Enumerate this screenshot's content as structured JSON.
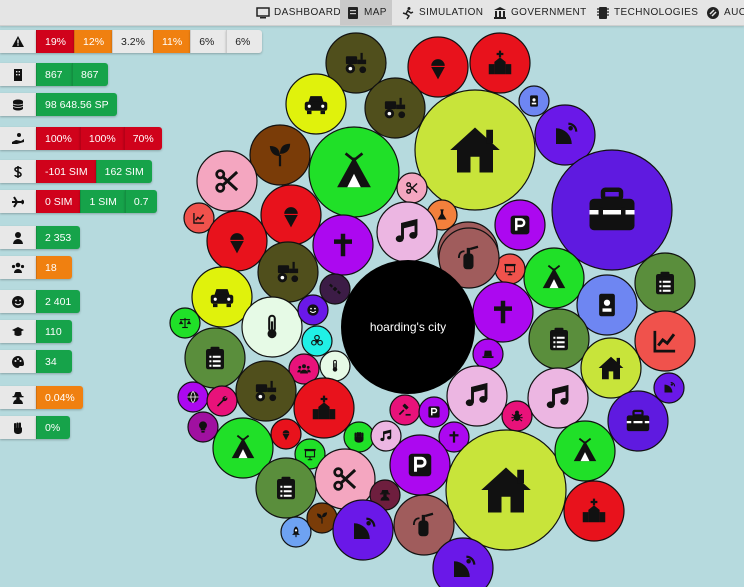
{
  "nav": {
    "items": [
      {
        "label": "DASHBOARD",
        "icon": "monitor-icon",
        "active": false
      },
      {
        "label": "MAP",
        "icon": "map-icon",
        "active": true
      },
      {
        "label": "SIMULATION",
        "icon": "running-icon",
        "active": false
      },
      {
        "label": "GOVERNMENT",
        "icon": "landmark-icon",
        "active": false
      },
      {
        "label": "TECHNOLOGIES",
        "icon": "microchip-icon",
        "active": false
      },
      {
        "label": "AUCT",
        "icon": "gavel-icon",
        "active": false
      }
    ]
  },
  "colors": {
    "red": "#d0021b",
    "orange": "#f08010",
    "green": "#16a34a",
    "grey": "#e9e9e9",
    "background": "#b6dade"
  },
  "stats": [
    {
      "name": "warning",
      "icon": "warning-icon",
      "cells": [
        {
          "text": "19%",
          "color": "red"
        },
        {
          "text": "12%",
          "color": "orange"
        },
        {
          "text": "3.2%",
          "color": "grey"
        },
        {
          "text": "11%",
          "color": "orange"
        },
        {
          "text": "6%",
          "color": "grey"
        },
        {
          "text": "6%",
          "color": "grey"
        }
      ]
    },
    {
      "name": "buildings",
      "icon": "building-icon",
      "cells": [
        {
          "text": "867",
          "color": "green"
        },
        {
          "text": "867",
          "color": "green"
        }
      ]
    },
    {
      "name": "money",
      "icon": "coins-icon",
      "cells": [
        {
          "text": "98 648.56 SP",
          "color": "green"
        }
      ]
    },
    {
      "name": "donation",
      "icon": "hand-holding-icon",
      "cells": [
        {
          "text": "100%",
          "color": "red"
        },
        {
          "text": "100%",
          "color": "red"
        },
        {
          "text": "70%",
          "color": "red"
        }
      ]
    },
    {
      "name": "dollar",
      "icon": "dollar-icon",
      "cells": [
        {
          "text": "-101 SIM",
          "color": "red"
        },
        {
          "text": "162 SIM",
          "color": "green"
        }
      ]
    },
    {
      "name": "travel",
      "icon": "plane-icon",
      "cells": [
        {
          "text": "0 SIM",
          "color": "red"
        },
        {
          "text": "1 SIM",
          "color": "green"
        },
        {
          "text": "0.7",
          "color": "green"
        }
      ]
    },
    {
      "name": "population",
      "icon": "user-icon",
      "cells": [
        {
          "text": "2 353",
          "color": "green"
        }
      ]
    },
    {
      "name": "groups",
      "icon": "users-icon",
      "cells": [
        {
          "text": "18",
          "color": "orange"
        }
      ]
    },
    {
      "name": "happiness",
      "icon": "smile-icon",
      "cells": [
        {
          "text": "2 401",
          "color": "green"
        }
      ]
    },
    {
      "name": "education",
      "icon": "graduation-cap-icon",
      "cells": [
        {
          "text": "110",
          "color": "green"
        }
      ]
    },
    {
      "name": "culture",
      "icon": "palette-icon",
      "cells": [
        {
          "text": "34",
          "color": "green"
        }
      ]
    },
    {
      "name": "crime",
      "icon": "user-secret-icon",
      "cells": [
        {
          "text": "0.04%",
          "color": "orange"
        }
      ]
    },
    {
      "name": "protest",
      "icon": "fist-icon",
      "cells": [
        {
          "text": "0%",
          "color": "green"
        }
      ]
    }
  ],
  "city": {
    "name": "hoarding's city"
  },
  "bubbles": [
    {
      "icon": "tractor-icon",
      "color": "#504f1c"
    },
    {
      "icon": "ice-cream-icon",
      "color": "#e8121c"
    },
    {
      "icon": "church-icon",
      "color": "#e8121c"
    },
    {
      "icon": "car-icon",
      "color": "#e0f20c"
    },
    {
      "icon": "tractor-icon",
      "color": "#504f1c"
    },
    {
      "icon": "id-badge-icon",
      "color": "#6e86f2"
    },
    {
      "icon": "house-icon",
      "color": "#c8e43a"
    },
    {
      "icon": "satellite-dish-icon",
      "color": "#6a18e8"
    },
    {
      "icon": "seedling-icon",
      "color": "#7a3c08"
    },
    {
      "icon": "campground-icon",
      "color": "#20e028"
    },
    {
      "icon": "toolbox-icon",
      "color": "#5f1ae0"
    },
    {
      "icon": "scissors-icon",
      "color": "#f4a6c0"
    },
    {
      "icon": "scissors-icon",
      "color": "#f4a6c0"
    },
    {
      "icon": "ice-cream-icon",
      "color": "#e8121c"
    },
    {
      "icon": "flask-icon",
      "color": "#f3803c"
    },
    {
      "icon": "parking-icon",
      "color": "#ac08f0"
    },
    {
      "icon": "chart-line-icon",
      "color": "#f0524c"
    },
    {
      "icon": "ice-cream-icon",
      "color": "#e8121c"
    },
    {
      "icon": "cross-icon",
      "color": "#ac08f0"
    },
    {
      "icon": "music-icon",
      "color": "#ecb6e2"
    },
    {
      "icon": "fire-extinguisher-icon",
      "color": "#a05c5c"
    },
    {
      "icon": "campground-icon",
      "color": "#20e028"
    },
    {
      "icon": "clipboard-icon",
      "color": "#5a8e3c"
    },
    {
      "icon": "tractor-icon",
      "color": "#504f1c"
    },
    {
      "icon": "presentation-icon",
      "color": "#f0524c"
    },
    {
      "icon": "car-icon",
      "color": "#e0f20c"
    },
    {
      "icon": "satellite-icon",
      "color": "#3c1c46"
    },
    {
      "icon": "id-badge-icon",
      "color": "#6e86f2"
    },
    {
      "icon": "thermometer-icon",
      "color": "#e6fae6"
    },
    {
      "icon": "smile-icon",
      "color": "#6a18e8"
    },
    {
      "icon": "cross-icon",
      "color": "#ac08f0"
    },
    {
      "icon": "balance-scale-icon",
      "color": "#20e028"
    },
    {
      "icon": "chart-line-icon",
      "color": "#f0524c"
    },
    {
      "icon": "biohazard-icon",
      "color": "#20f0e6"
    },
    {
      "icon": "clipboard-icon",
      "color": "#5a8e3c"
    },
    {
      "icon": "hat-icon",
      "color": "#ac08f0"
    },
    {
      "icon": "clipboard-icon",
      "color": "#5a8e3c"
    },
    {
      "icon": "users-icon",
      "color": "#e8127a"
    },
    {
      "icon": "thermometer-icon",
      "color": "#e6fae6"
    },
    {
      "icon": "house-icon",
      "color": "#c8e43a"
    },
    {
      "icon": "satellite-dish-icon",
      "color": "#6a18e8"
    },
    {
      "icon": "tractor-icon",
      "color": "#504f1c"
    },
    {
      "icon": "church-icon",
      "color": "#e8121c"
    },
    {
      "icon": "music-icon",
      "color": "#ecb6e2"
    },
    {
      "icon": "music-icon",
      "color": "#ecb6e2"
    },
    {
      "icon": "fire-extinguisher-icon",
      "color": "#a05c5c"
    },
    {
      "icon": "globe-icon",
      "color": "#ac08f0"
    },
    {
      "icon": "wrench-icon",
      "color": "#e8127a"
    },
    {
      "icon": "gavel-icon",
      "color": "#e8127a"
    },
    {
      "icon": "parking-icon",
      "color": "#ac08f0"
    },
    {
      "icon": "bug-icon",
      "color": "#e8127a"
    },
    {
      "icon": "toolbox-icon",
      "color": "#5f1ae0"
    },
    {
      "icon": "lightbulb-icon",
      "color": "#a010a0"
    },
    {
      "icon": "campground-icon",
      "color": "#20e028"
    },
    {
      "icon": "ice-cream-icon",
      "color": "#e8121c"
    },
    {
      "icon": "presentation-icon",
      "color": "#20e028"
    },
    {
      "icon": "fist-icon",
      "color": "#20e028"
    },
    {
      "icon": "music-icon",
      "color": "#ecb6e2"
    },
    {
      "icon": "cross-icon",
      "color": "#ac08f0"
    },
    {
      "icon": "parking-icon",
      "color": "#ac08f0"
    },
    {
      "icon": "house-icon",
      "color": "#c8e43a"
    },
    {
      "icon": "campground-icon",
      "color": "#20e028"
    },
    {
      "icon": "scissors-icon",
      "color": "#f4a6c0"
    },
    {
      "icon": "clipboard-icon",
      "color": "#5a8e3c"
    },
    {
      "icon": "user-secret-icon",
      "color": "#6e1e3e"
    },
    {
      "icon": "fire-extinguisher-icon",
      "color": "#a05c5c"
    },
    {
      "icon": "church-icon",
      "color": "#e8121c"
    },
    {
      "icon": "rocket-icon",
      "color": "#6ea2f2"
    },
    {
      "icon": "seedling-icon",
      "color": "#7a3c08"
    },
    {
      "icon": "satellite-dish-icon",
      "color": "#6a18e8"
    },
    {
      "icon": "satellite-dish-icon",
      "color": "#6a18e8"
    }
  ]
}
